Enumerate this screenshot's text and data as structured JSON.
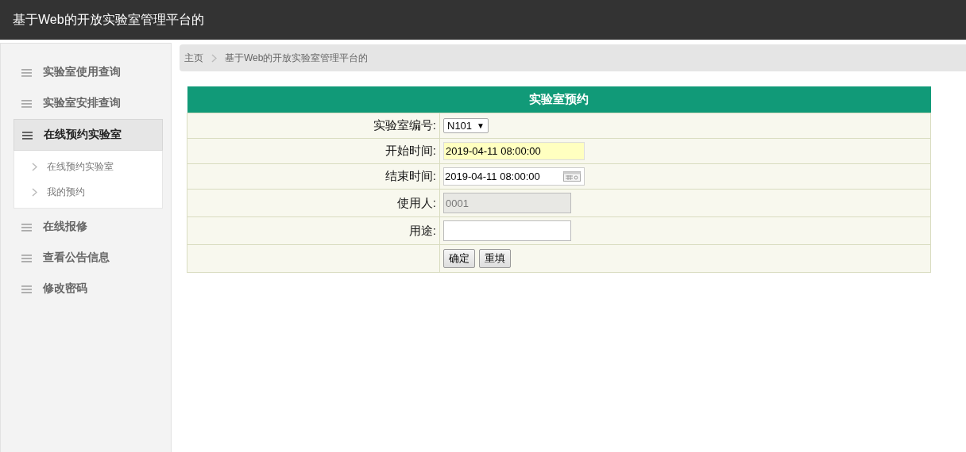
{
  "header": {
    "title": "基于Web的开放实验室管理平台的"
  },
  "sidebar": {
    "items": [
      {
        "label": "实验室使用查询",
        "selected": false
      },
      {
        "label": "实验室安排查询",
        "selected": false
      },
      {
        "label": "在线预约实验室",
        "selected": true,
        "expanded": true,
        "children": [
          {
            "label": "在线预约实验室"
          },
          {
            "label": "我的预约"
          }
        ]
      },
      {
        "label": "在线报修",
        "selected": false
      },
      {
        "label": "查看公告信息",
        "selected": false
      },
      {
        "label": "修改密码",
        "selected": false
      }
    ]
  },
  "breadcrumb": [
    "主页",
    "基于Web的开放实验室管理平台的"
  ],
  "form": {
    "title": "实验室预约",
    "rows": [
      {
        "kind": "select",
        "label": "实验室编号:",
        "value": "N101",
        "caret": "▼"
      },
      {
        "kind": "input",
        "label": "开始时间:",
        "value": "2019-04-11 08:00:00",
        "focused": true
      },
      {
        "kind": "date",
        "label": "结束时间:",
        "value": "2019-04-11 08:00:00",
        "focused": false
      },
      {
        "kind": "input",
        "label": "使用人:",
        "value": "0001",
        "disabled": true
      },
      {
        "kind": "input",
        "label": "用途:",
        "disabled": false
      },
      {
        "kind": "buttons",
        "buttons": [
          "确定",
          "重填"
        ]
      }
    ]
  }
}
